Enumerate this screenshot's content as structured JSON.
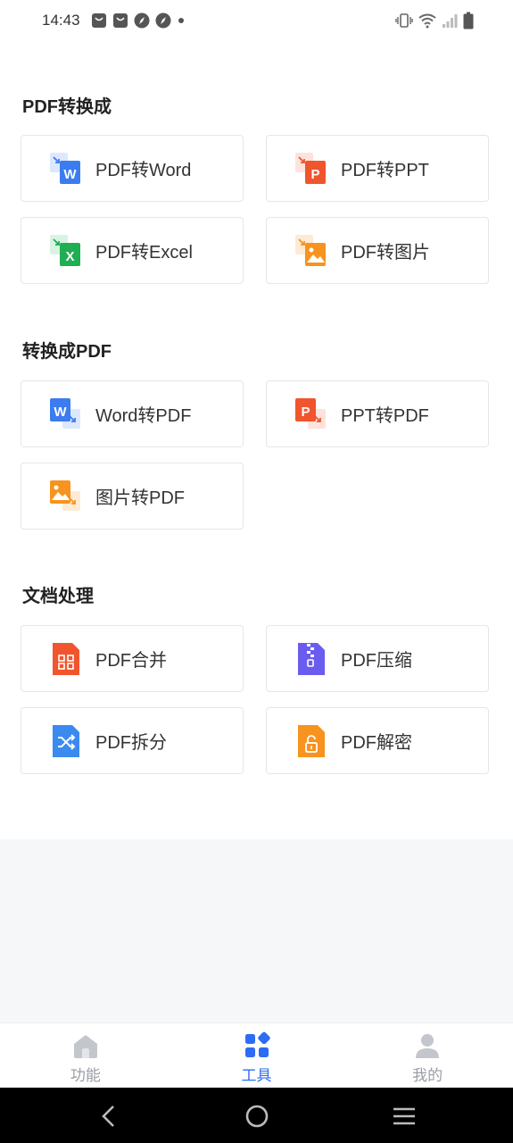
{
  "status_bar": {
    "time": "14:43",
    "left_icons": [
      "bag-icon",
      "bag-icon",
      "compass-icon",
      "compass-icon",
      "dot-icon"
    ],
    "right_icons": [
      "vibrate-icon",
      "wifi-icon",
      "signal-icon",
      "battery-icon"
    ]
  },
  "sections": [
    {
      "title": "PDF转换成",
      "items": [
        {
          "label": "PDF转Word",
          "icon": "pdf-to-word-icon",
          "color": "#3b7cf0"
        },
        {
          "label": "PDF转PPT",
          "icon": "pdf-to-ppt-icon",
          "color": "#f0552e"
        },
        {
          "label": "PDF转Excel",
          "icon": "pdf-to-excel-icon",
          "color": "#1fae52"
        },
        {
          "label": "PDF转图片",
          "icon": "pdf-to-image-icon",
          "color": "#f7931e"
        }
      ]
    },
    {
      "title": "转换成PDF",
      "items": [
        {
          "label": "Word转PDF",
          "icon": "word-to-pdf-icon",
          "color": "#3b7cf0"
        },
        {
          "label": "PPT转PDF",
          "icon": "ppt-to-pdf-icon",
          "color": "#f0552e"
        },
        {
          "label": "图片转PDF",
          "icon": "image-to-pdf-icon",
          "color": "#f7931e"
        }
      ]
    },
    {
      "title": "文档处理",
      "items": [
        {
          "label": "PDF合并",
          "icon": "pdf-merge-icon",
          "color": "#f0552e"
        },
        {
          "label": "PDF压缩",
          "icon": "pdf-compress-icon",
          "color": "#6b5cf0"
        },
        {
          "label": "PDF拆分",
          "icon": "pdf-split-icon",
          "color": "#3b8af0"
        },
        {
          "label": "PDF解密",
          "icon": "pdf-decrypt-icon",
          "color": "#f7931e"
        }
      ]
    }
  ],
  "tabs": [
    {
      "label": "功能",
      "icon": "home-icon",
      "active": false
    },
    {
      "label": "工具",
      "icon": "tools-grid-icon",
      "active": true
    },
    {
      "label": "我的",
      "icon": "user-icon",
      "active": false
    }
  ],
  "colors": {
    "accent": "#2d6cf4",
    "inactive": "#9a9ea6",
    "border": "#e4e6ea",
    "background_grey": "#f6f7f9"
  },
  "nav": [
    "back-icon",
    "home-circle-icon",
    "menu-icon"
  ]
}
